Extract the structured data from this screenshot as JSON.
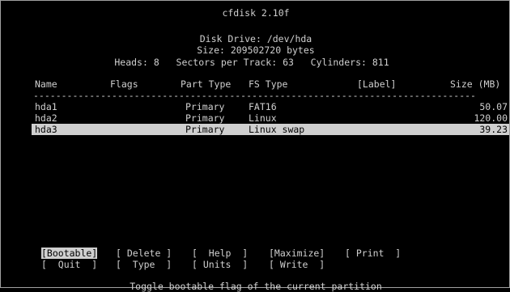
{
  "app": {
    "title": "cfdisk 2.10f"
  },
  "disk": {
    "drive_line": "Disk Drive: /dev/hda",
    "size_line": "Size: 209502720 bytes",
    "geometry_line": "Heads: 8   Sectors per Track: 63   Cylinders: 811"
  },
  "table": {
    "columns": {
      "name": "Name",
      "flags": "Flags",
      "part_type": "Part Type",
      "fs_type": "FS Type",
      "label": "[Label]",
      "size": "Size (MB)"
    },
    "separator": "-------------------------------------------------------------------------------",
    "rows": [
      {
        "name": "hda1",
        "flags": "",
        "part_type": "Primary",
        "fs_type": "FAT16",
        "label": "",
        "size": "50.07",
        "selected": false
      },
      {
        "name": "hda2",
        "flags": "",
        "part_type": "Primary",
        "fs_type": "Linux",
        "label": "",
        "size": "120.00",
        "selected": false
      },
      {
        "name": "hda3",
        "flags": "",
        "part_type": "Primary",
        "fs_type": "Linux swap",
        "label": "",
        "size": "39.23",
        "selected": true
      }
    ]
  },
  "menu": {
    "row1": [
      {
        "label": "[Bootable]",
        "active": true
      },
      {
        "label": "[ Delete ]",
        "active": false
      },
      {
        "label": "[  Help  ]",
        "active": false
      },
      {
        "label": "[Maximize]",
        "active": false
      },
      {
        "label": "[ Print  ]",
        "active": false
      }
    ],
    "row2": [
      {
        "label": "[  Quit  ]",
        "active": false
      },
      {
        "label": "[  Type  ]",
        "active": false
      },
      {
        "label": "[ Units  ]",
        "active": false
      },
      {
        "label": "[ Write  ]",
        "active": false
      }
    ]
  },
  "status": {
    "message": "Toggle bootable flag of the current partition"
  }
}
